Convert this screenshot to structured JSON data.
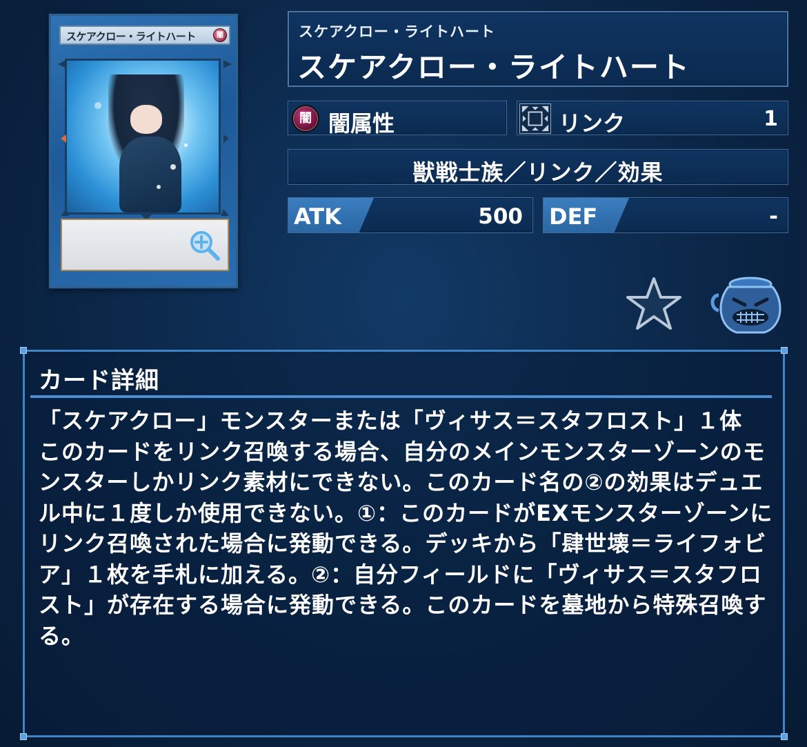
{
  "card": {
    "name_on_card": "スケアクロー・ライトハート",
    "attribute_glyph": "闇",
    "zoom_icon": "magnify-plus-icon"
  },
  "header": {
    "ruby": "スケアクロー・ライトハート",
    "name": "スケアクロー・ライトハート"
  },
  "attribute": {
    "icon_glyph": "闇",
    "label": "闇属性",
    "color": "#7a1640"
  },
  "link": {
    "label": "リンク",
    "value": "1"
  },
  "type_line": "獣戦士族／リンク／効果",
  "stats": {
    "atk_label": "ATK",
    "atk_value": "500",
    "def_label": "DEF",
    "def_value": "-"
  },
  "actions": {
    "favorite_icon": "star-icon",
    "pot_icon": "pot-of-greed-icon"
  },
  "details": {
    "title": "カード詳細",
    "text": "「スケアクロー」モンスターまたは「ヴィサス＝スタフロスト」１体\nこのカードをリンク召喚する場合、自分のメインモンスターゾーンのモンスターしかリンク素材にできない。このカード名の②の効果はデュエル中に１度しか使用できない。①：このカードがEXモンスターゾーンにリンク召喚された場合に発動できる。デッキから「肆世壊＝ライフォビア」１枚を手札に加える。②：自分フィールドに「ヴィサス＝スタフロスト」が存在する場合に発動できる。このカードを墓地から特殊召喚する。"
  },
  "colors": {
    "background": "#0a2342",
    "accent": "#3f84c7",
    "stat_tag": "#3b7ec0"
  }
}
